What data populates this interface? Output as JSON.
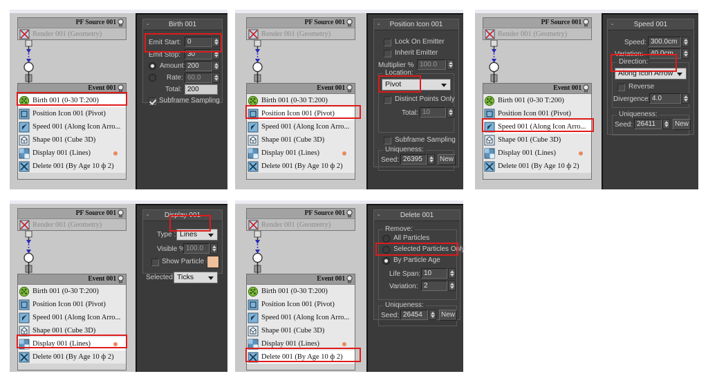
{
  "app": {
    "flow_panel_title": "PF Source 001",
    "render_operator": "Render 001 (Geometry)",
    "event_title": "Event 001",
    "operators": [
      {
        "label": "Birth 001 (0-30 T:200)",
        "icon": "birth-icon"
      },
      {
        "label": "Position Icon 001 (Pivot)",
        "icon": "position-icon"
      },
      {
        "label": "Speed 001 (Along Icon Arro...",
        "icon": "speed-icon"
      },
      {
        "label": "Shape 001 (Cube 3D)",
        "icon": "shape-icon"
      },
      {
        "label": "Display 001 (Lines)",
        "icon": "display-icon",
        "dot": true
      },
      {
        "label": "Delete 001 (By Age 10 ф 2)",
        "icon": "delete-icon"
      }
    ],
    "collapse_glyph": "-"
  },
  "figures": [
    {
      "id": "birth",
      "selected_operator_index": 0,
      "panel": {
        "title": "Birth 001",
        "fields": [
          {
            "label": "Emit Start:",
            "value": "0",
            "spinner": true
          },
          {
            "label": "Emit Stop:",
            "value": "30",
            "spinner": true
          },
          {
            "label": "Amount:",
            "value": "200",
            "spinner": true,
            "radio": "on"
          },
          {
            "label": "Rate:",
            "value": "60.0",
            "spinner": true,
            "radio": "off"
          },
          {
            "label": "Total:",
            "value": "200",
            "spinner": false
          }
        ],
        "checkbox": {
          "label": "Subframe Sampling",
          "checked": true
        }
      }
    },
    {
      "id": "position",
      "selected_operator_index": 1,
      "panel": {
        "title": "Position Icon 001",
        "lock_on_emitter": "Lock On Emitter",
        "inherit_emitter": "Inherit Emitter",
        "multiplier_label": "Multiplier %",
        "multiplier_value": "100.0",
        "location_group": "Location:",
        "location_value": "Pivot",
        "distinct_points": "Distinct Points Only",
        "total_label": "Total:",
        "total_value": "10",
        "subframe_label": "Subframe Sampling",
        "uniqueness_group": "Uniqueness:",
        "seed_label": "Seed:",
        "seed_value": "26395",
        "new_button": "New"
      }
    },
    {
      "id": "speed",
      "selected_operator_index": 2,
      "panel": {
        "title": "Speed 001",
        "speed_label": "Speed:",
        "speed_value": "300.0cm",
        "variation_label": "Variation:",
        "variation_value": "40.0cm",
        "direction_group": "Direction:",
        "direction_value": "Along Icon Arrow",
        "reverse_label": "Reverse",
        "divergence_label": "Divergence:",
        "divergence_value": "4.0",
        "uniqueness_group": "Uniqueness:",
        "seed_label": "Seed:",
        "seed_value": "26411",
        "new_button": "New"
      }
    },
    {
      "id": "display",
      "selected_operator_index": 4,
      "panel": {
        "title": "Display 001",
        "type_label": "Type :",
        "type_value": "Lines",
        "visible_label": "Visible %",
        "visible_value": "100.0",
        "show_ids_label": "Show Particle IDs",
        "selected_label": "Selected:",
        "selected_value": "Ticks",
        "swatch_color": "#f0bf9b"
      }
    },
    {
      "id": "delete",
      "selected_operator_index": 5,
      "panel": {
        "title": "Delete 001",
        "remove_group": "Remove:",
        "radios": [
          {
            "label": "All Particles",
            "checked": false
          },
          {
            "label": "Selected Particles Only",
            "checked": false
          },
          {
            "label": "By Particle Age",
            "checked": true
          }
        ],
        "life_span_label": "Life Span:",
        "life_span_value": "10",
        "variation_label": "Variation:",
        "variation_value": "2",
        "uniqueness_group": "Uniqueness:",
        "seed_label": "Seed:",
        "seed_value": "26454",
        "new_button": "New"
      }
    }
  ],
  "colors": {
    "annotation": "#e01b1b",
    "panel_dark": "#3a3a3a",
    "flow_bg": "#c8c8c8",
    "accent_dot": "#e88a5e"
  }
}
